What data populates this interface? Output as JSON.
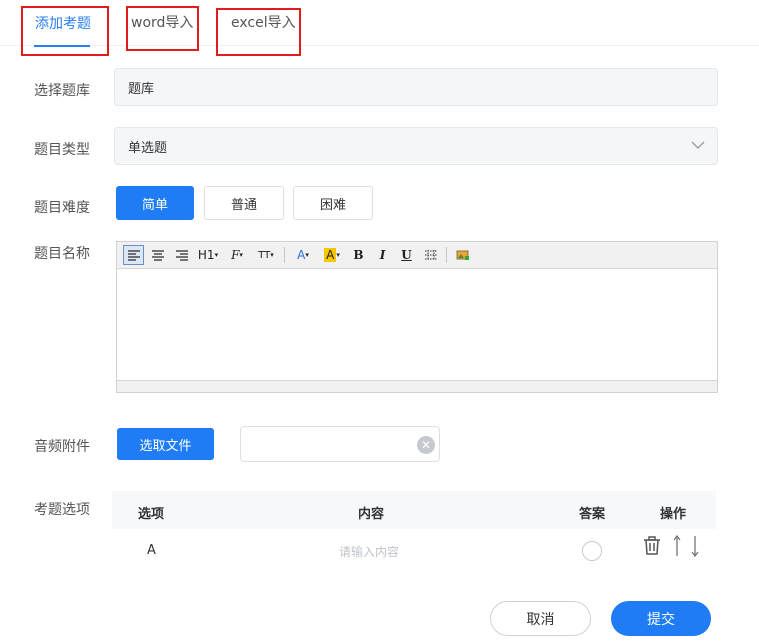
{
  "tabs": [
    {
      "label": "添加考题",
      "active": true
    },
    {
      "label": "word导入",
      "active": false
    },
    {
      "label": "excel导入",
      "active": false
    }
  ],
  "form": {
    "bank_label": "选择题库",
    "bank_value": "题库",
    "type_label": "题目类型",
    "type_value": "单选题",
    "difficulty_label": "题目难度",
    "difficulty_options": [
      "简单",
      "普通",
      "困难"
    ],
    "difficulty_selected": "简单",
    "name_label": "题目名称",
    "audio_label": "音频附件",
    "choose_file_label": "选取文件",
    "options_label": "考题选项"
  },
  "editor_toolbar": {
    "heading": "H1",
    "font": "F",
    "size": "TT",
    "color": "A",
    "bgcolor": "A",
    "bold": "B",
    "italic": "I",
    "underline": "U"
  },
  "options_table": {
    "columns": [
      "选项",
      "内容",
      "答案",
      "操作"
    ],
    "rows": [
      {
        "option": "A",
        "content_placeholder": "请输入内容"
      }
    ]
  },
  "actions": {
    "cancel_label": "取消",
    "submit_label": "提交"
  },
  "colors": {
    "accent": "#1f7cf5",
    "highlight_border": "#e31b1b"
  }
}
